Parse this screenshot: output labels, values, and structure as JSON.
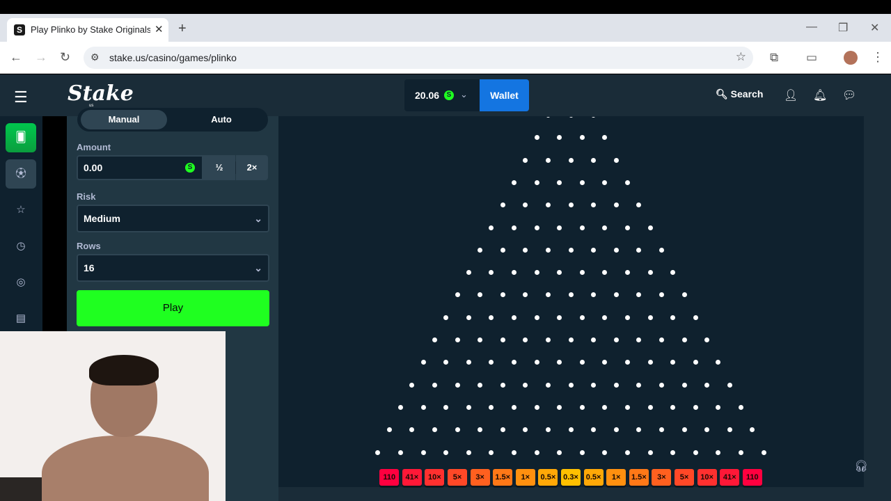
{
  "browser": {
    "tab_title": "Play Plinko by Stake Originals C",
    "url": "stake.us/casino/games/plinko"
  },
  "header": {
    "logo": "Stake",
    "logo_sub": "us",
    "balance": "20.06",
    "currency_symbol": "S",
    "wallet_label": "Wallet",
    "search_label": "Search"
  },
  "panel": {
    "mode_manual": "Manual",
    "mode_auto": "Auto",
    "amount_label": "Amount",
    "amount_value": "0.00",
    "half_label": "½",
    "double_label": "2×",
    "risk_label": "Risk",
    "risk_value": "Medium",
    "rows_label": "Rows",
    "rows_value": "16",
    "play_label": "Play"
  },
  "board": {
    "rows": 16,
    "multipliers": [
      "110",
      "41×",
      "10×",
      "5×",
      "3×",
      "1.5×",
      "1×",
      "0.5×",
      "0.3×",
      "0.5×",
      "1×",
      "1.5×",
      "3×",
      "5×",
      "10×",
      "41×",
      "110"
    ],
    "multiplier_colors": [
      "#ff003f",
      "#ff1837",
      "#ff302f",
      "#ff4827",
      "#ff601f",
      "#ff7817",
      "#ff900f",
      "#ffa807",
      "#ffc000",
      "#ffa807",
      "#ff900f",
      "#ff7817",
      "#ff601f",
      "#ff4827",
      "#ff302f",
      "#ff1837",
      "#ff003f"
    ]
  },
  "colors": {
    "accent_green": "#1fff20",
    "wallet_blue": "#1475e1",
    "bg_dark": "#0f212e",
    "panel_bg": "#213743"
  }
}
